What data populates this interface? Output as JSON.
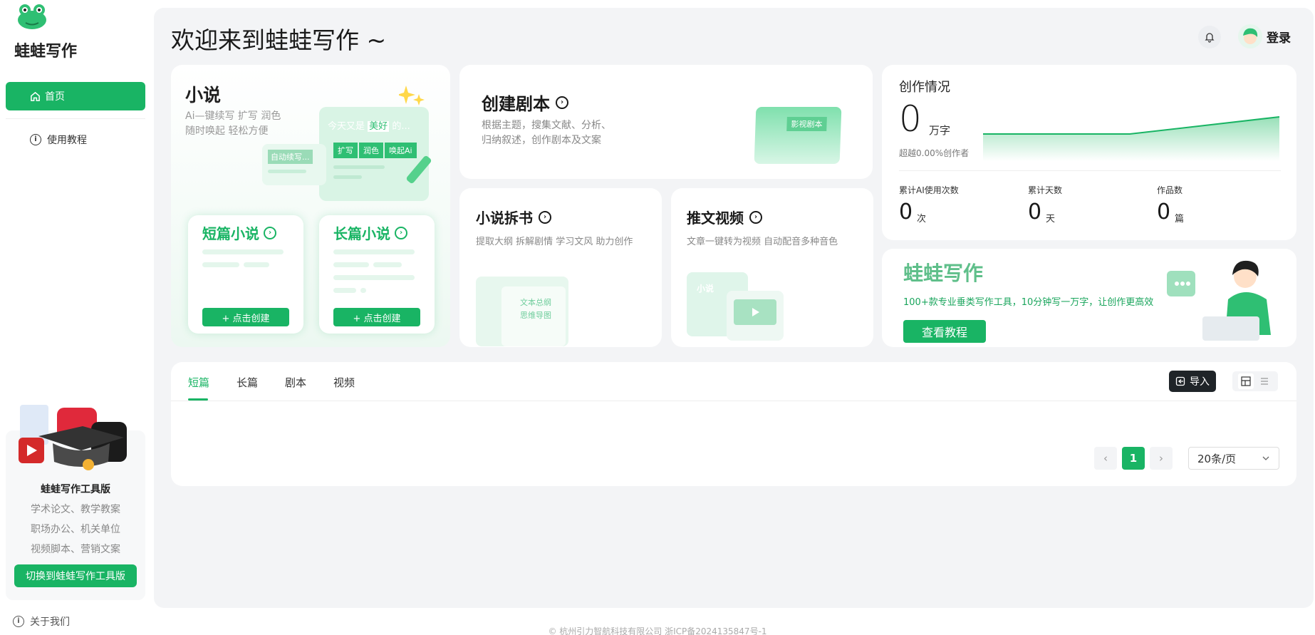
{
  "brand": {
    "name": "蛙蛙写作"
  },
  "sidebar": {
    "items": [
      {
        "label": "首页",
        "icon": "home-icon",
        "active": true
      },
      {
        "label": "使用教程",
        "icon": "info-icon",
        "active": false
      }
    ],
    "promo": {
      "title": "蛙蛙写作工具版",
      "lines": [
        "学术论文、教学教案",
        "职场办公、机关单位",
        "视频脚本、营销文案"
      ],
      "button": "切换到蛙蛙写作工具版"
    },
    "about": "关于我们"
  },
  "header": {
    "welcome": "欢迎来到蛙蛙写作 ~",
    "login": "登录"
  },
  "novel": {
    "title": "小说",
    "desc1": "Ai—键续写 扩写 润色",
    "desc2": "随时唤起 轻松方便",
    "illus": {
      "line1": "今天又是",
      "highlight": "美好",
      "suffix": "的...",
      "chip1": "扩写",
      "chip2": "润色",
      "chip3": "唤起Ai",
      "auto": "自动续写..."
    },
    "short": {
      "title": "短篇小说",
      "button": "+ 点击创建"
    },
    "long": {
      "title": "长篇小说",
      "button": "+ 点击创建"
    }
  },
  "script": {
    "title": "创建剧本",
    "desc1": "根据主题，搜集文献、分析、",
    "desc2": "归纳叙述，创作剧本及文案",
    "illus_label": "影视剧本"
  },
  "split": {
    "title": "小说拆书",
    "desc": "提取大纲 拆解剧情 学习文风 助力创作",
    "illus1": "文本总纲",
    "illus2": "思维导图"
  },
  "video": {
    "title": "推文视频",
    "desc": "文章一键转为视频 自动配音多种音色",
    "illus": "小说"
  },
  "stats": {
    "title": "创作情况",
    "words": "0",
    "words_unit": "万字",
    "beat": "超越0.00%创作者",
    "items": [
      {
        "label": "累计AI使用次数",
        "value": "0",
        "unit": "次"
      },
      {
        "label": "累计天数",
        "value": "0",
        "unit": "天"
      },
      {
        "label": "作品数",
        "value": "0",
        "unit": "篇"
      }
    ]
  },
  "promo_card": {
    "title": "蛙蛙写作",
    "subtitle": "100+款专业垂类写作工具，10分钟写一万字，让创作更高效",
    "button": "查看教程"
  },
  "tabs": [
    "短篇",
    "长篇",
    "剧本",
    "视频"
  ],
  "toolbar": {
    "import": "导入"
  },
  "pagination": {
    "current": "1",
    "page_size": "20条/页"
  },
  "footer": "© 杭州引力智航科技有限公司 浙ICP备2024135847号-1",
  "colors": {
    "accent": "#19b464",
    "bg": "#f3f4f6"
  }
}
